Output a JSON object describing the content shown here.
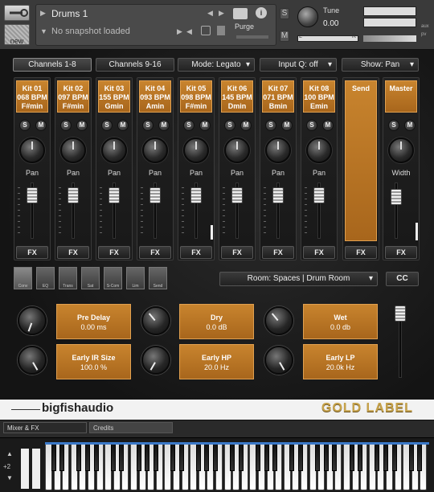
{
  "header": {
    "instrument_name": "Drums 1",
    "snapshot": "No snapshot loaded",
    "new_label": "new",
    "purge_label": "Purge",
    "s_label": "S",
    "m_label": "M",
    "tune_label": "Tune",
    "tune_value": "0.00",
    "aux_label": "aux",
    "pv_label": "pv",
    "l_label": "L",
    "r_label": "R"
  },
  "topbar": {
    "channels_1_8": "Channels 1-8",
    "channels_9_16": "Channels 9-16",
    "mode": "Mode: Legato",
    "input_q": "Input Q: off",
    "show": "Show: Pan"
  },
  "channels": [
    {
      "line1": "Kit 01",
      "line2": "068 BPM",
      "line3": "F#min"
    },
    {
      "line1": "Kit 02",
      "line2": "097 BPM",
      "line3": "F#min"
    },
    {
      "line1": "Kit 03",
      "line2": "155 BPM",
      "line3": "Gmin"
    },
    {
      "line1": "Kit 04",
      "line2": "093 BPM",
      "line3": "Amin"
    },
    {
      "line1": "Kit 05",
      "line2": "098 BPM",
      "line3": "F#min"
    },
    {
      "line1": "Kit 06",
      "line2": "145 BPM",
      "line3": "Dmin"
    },
    {
      "line1": "Kit 07",
      "line2": "071 BPM",
      "line3": "Bmin"
    },
    {
      "line1": "Kit 08",
      "line2": "100 BPM",
      "line3": "Emin"
    }
  ],
  "channel_labels": {
    "pan": "Pan",
    "fx": "FX",
    "solo": "S",
    "mute": "M"
  },
  "send": {
    "label": "Send",
    "fx": "FX"
  },
  "master": {
    "label": "Master",
    "width_label": "Width",
    "fx": "FX"
  },
  "fx_tabs": [
    "Conv",
    "EQ",
    "Trans",
    "Sat",
    "S-Com",
    "Lim",
    "Send"
  ],
  "room_select": "Room: Spaces | Drum Room",
  "cc_button": "CC",
  "params": {
    "pre_delay": {
      "label": "Pre Delay",
      "value": "0.00 ms"
    },
    "early_ir": {
      "label": "Early IR Size",
      "value": "100.0 %"
    },
    "dry": {
      "label": "Dry",
      "value": "0.0 dB"
    },
    "early_hp": {
      "label": "Early HP",
      "value": "20.0 Hz"
    },
    "wet": {
      "label": "Wet",
      "value": "0.0 db"
    },
    "early_lp": {
      "label": "Early LP",
      "value": "20.0k Hz"
    }
  },
  "footer": {
    "brand": "bigfishaudio",
    "gold": "GOLD LABEL"
  },
  "bottom_tabs": {
    "mixer": "Mixer & FX",
    "credits": "Credits"
  },
  "keyboard": {
    "octave": "+2"
  }
}
